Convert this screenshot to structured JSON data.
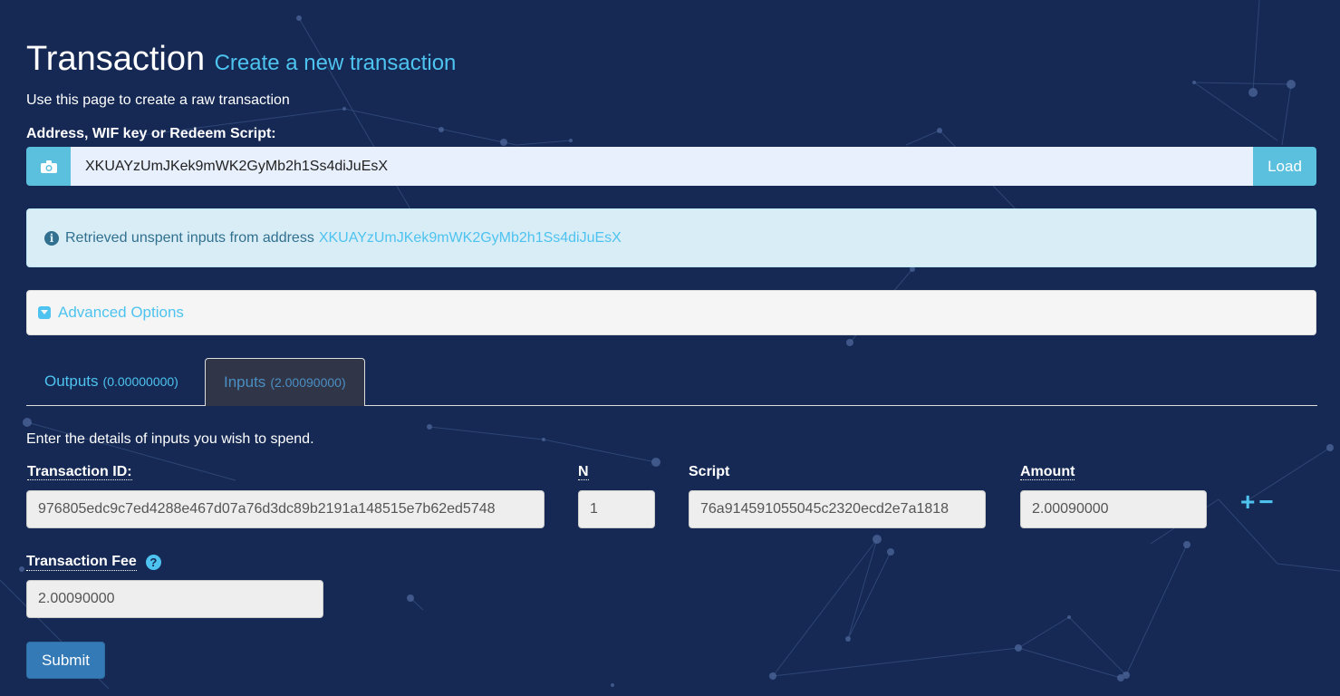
{
  "header": {
    "title": "Transaction",
    "subtitle": "Create a new transaction",
    "intro": "Use this page to create a raw transaction"
  },
  "address": {
    "label": "Address, WIF key or Redeem Script:",
    "value": "XKUAYzUmJKek9mWK2GyMb2h1Ss4diJuEsX",
    "camera_icon": "camera-icon",
    "load_label": "Load"
  },
  "alert": {
    "text": "Retrieved unspent inputs from address",
    "address_link": "XKUAYzUmJKek9mWK2GyMb2h1Ss4diJuEsX",
    "icon": "info-icon"
  },
  "advanced": {
    "label": "Advanced Options",
    "icon": "caret-square-down-icon"
  },
  "tabs": [
    {
      "label": "Outputs",
      "count": "(0.00000000)",
      "active": false
    },
    {
      "label": "Inputs",
      "count": "(2.00090000)",
      "active": true
    }
  ],
  "inputs": {
    "help_text": "Enter the details of inputs you wish to spend.",
    "columns": {
      "txid": "Transaction ID:",
      "n": "N",
      "script": "Script",
      "amount": "Amount"
    },
    "rows": [
      {
        "txid": "976805edc9c7ed4288e467d07a76d3dc89b2191a148515e7b62ed5748",
        "n": "1",
        "script": "76a914591055045c2320ecd2e7a1818",
        "amount": "2.00090000"
      }
    ],
    "add_symbol": "+",
    "remove_symbol": "−"
  },
  "fee": {
    "label": "Transaction Fee",
    "value": "2.00090000",
    "help_symbol": "?"
  },
  "submit_label": "Submit",
  "colors": {
    "background": "#152954",
    "accent": "#4ec3ef",
    "info_button": "#5bc0de",
    "primary": "#337ab7"
  }
}
